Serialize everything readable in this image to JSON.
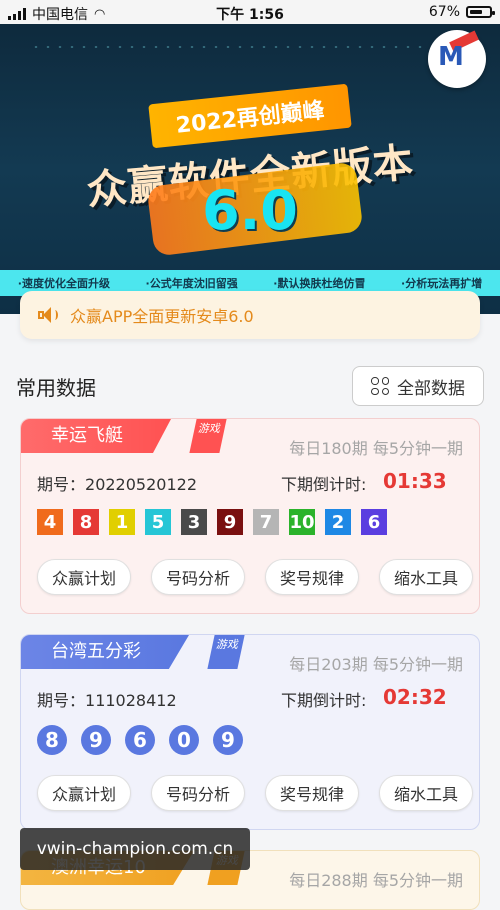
{
  "status_bar": {
    "carrier": "中国电信",
    "time": "下午 1:56",
    "battery": "67%",
    "battery_level": 0.67
  },
  "banner": {
    "headline": "2022再创巅峰",
    "main_title": "众赢软件全新版本",
    "version": "6.0",
    "features": [
      "·速度优化全面升级",
      "·公式年度沈旧留强",
      "·默认换肤杜绝仿冒",
      "·分析玩法再扩增"
    ],
    "slides": 3,
    "active_slide": 1
  },
  "notice": {
    "text": "众赢APP全面更新安卓6.0"
  },
  "section": {
    "title": "常用数据",
    "all_button": "全部数据"
  },
  "cards": [
    {
      "name": "幸运飞艇",
      "badge": "游戏",
      "frequency": "每日180期 每5分钟一期",
      "period_label": "期号：",
      "period": "20220520122",
      "countdown_label": "下期倒计时:",
      "countdown": "01:33",
      "numbers": [
        {
          "value": "4",
          "color": "#f06b1c"
        },
        {
          "value": "8",
          "color": "#e53935"
        },
        {
          "value": "1",
          "color": "#e1cf00"
        },
        {
          "value": "5",
          "color": "#26c6d6"
        },
        {
          "value": "3",
          "color": "#4a4a4a"
        },
        {
          "value": "9",
          "color": "#7a1010"
        },
        {
          "value": "7",
          "color": "#b5b5b5"
        },
        {
          "value": "10",
          "color": "#2bb32b"
        },
        {
          "value": "2",
          "color": "#1e88e5"
        },
        {
          "value": "6",
          "color": "#5a3ee0"
        }
      ],
      "actions": [
        "众赢计划",
        "号码分析",
        "奖号规律",
        "缩水工具"
      ]
    },
    {
      "name": "台湾五分彩",
      "badge": "游戏",
      "frequency": "每日203期 每5分钟一期",
      "period_label": "期号：",
      "period": "111028412",
      "countdown_label": "下期倒计时:",
      "countdown": "02:32",
      "numbers": [
        {
          "value": "8"
        },
        {
          "value": "9"
        },
        {
          "value": "6"
        },
        {
          "value": "0"
        },
        {
          "value": "9"
        }
      ],
      "actions": [
        "众赢计划",
        "号码分析",
        "奖号规律",
        "缩水工具"
      ]
    },
    {
      "name": "澳洲幸运10",
      "badge": "游戏",
      "frequency": "每日288期 每5分钟一期"
    }
  ],
  "watermark": "vwin-champion.com.cn"
}
